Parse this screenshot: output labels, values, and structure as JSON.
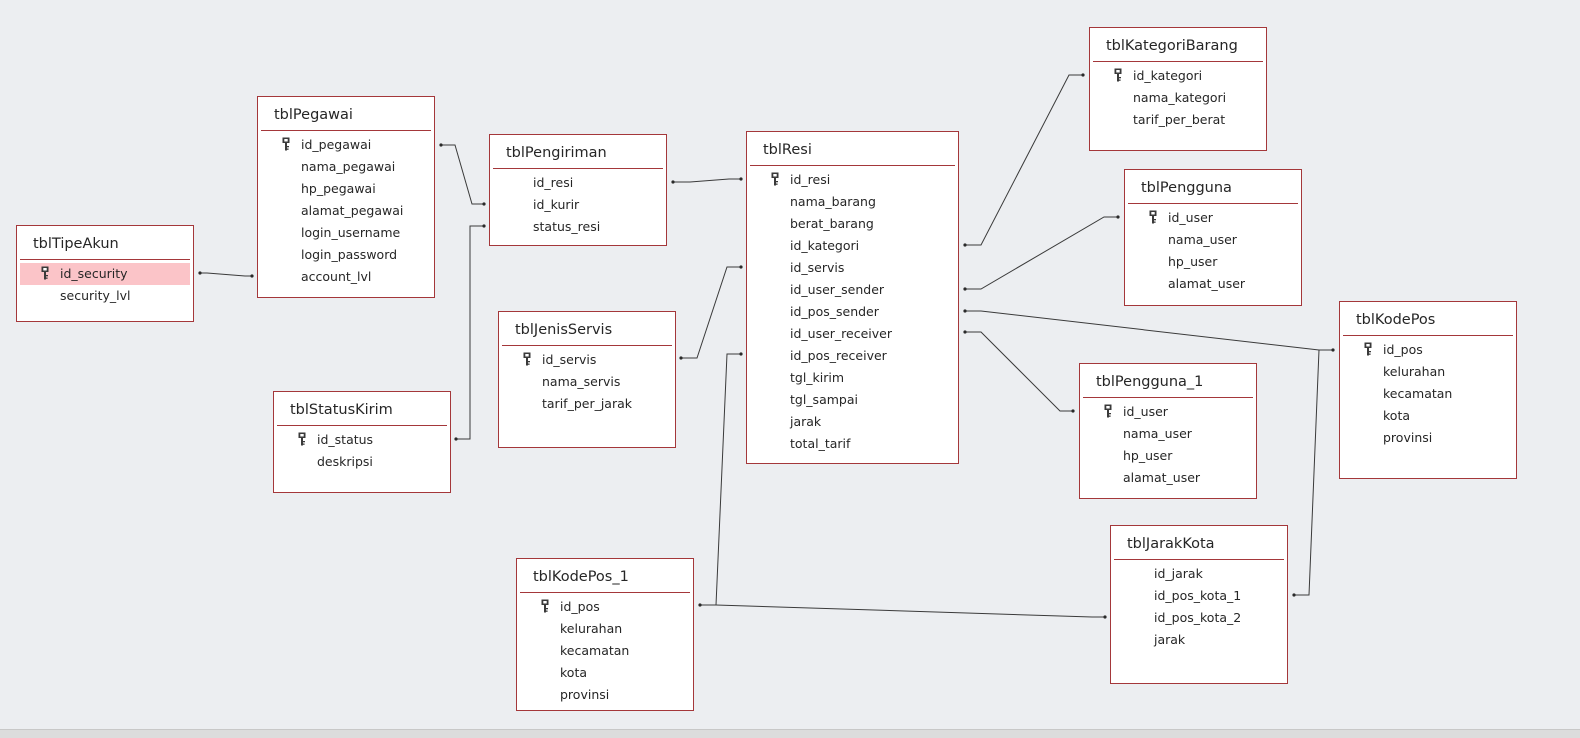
{
  "colors": {
    "background": "#eceef1",
    "table_border": "#a4373a",
    "selected_field": "#fbc4c8",
    "line": "#3a3a3a"
  },
  "tables": {
    "tipeakun": {
      "name": "tblTipeAkun",
      "fields": [
        {
          "name": "id_security",
          "pk": true,
          "selected": true
        },
        {
          "name": "security_lvl"
        }
      ]
    },
    "pegawai": {
      "name": "tblPegawai",
      "fields": [
        {
          "name": "id_pegawai",
          "pk": true
        },
        {
          "name": "nama_pegawai"
        },
        {
          "name": "hp_pegawai"
        },
        {
          "name": "alamat_pegawai"
        },
        {
          "name": "login_username"
        },
        {
          "name": "login_password"
        },
        {
          "name": "account_lvl"
        }
      ]
    },
    "statuskirim": {
      "name": "tblStatusKirim",
      "fields": [
        {
          "name": "id_status",
          "pk": true
        },
        {
          "name": "deskripsi"
        }
      ]
    },
    "pengiriman": {
      "name": "tblPengiriman",
      "fields": [
        {
          "name": "id_resi"
        },
        {
          "name": "id_kurir"
        },
        {
          "name": "status_resi"
        }
      ]
    },
    "jenisservis": {
      "name": "tblJenisServis",
      "fields": [
        {
          "name": "id_servis",
          "pk": true
        },
        {
          "name": "nama_servis"
        },
        {
          "name": "tarif_per_jarak"
        }
      ]
    },
    "kodepos1": {
      "name": "tblKodePos_1",
      "fields": [
        {
          "name": "id_pos",
          "pk": true
        },
        {
          "name": "kelurahan"
        },
        {
          "name": "kecamatan"
        },
        {
          "name": "kota"
        },
        {
          "name": "provinsi"
        }
      ]
    },
    "resi": {
      "name": "tblResi",
      "fields": [
        {
          "name": "id_resi",
          "pk": true
        },
        {
          "name": "nama_barang"
        },
        {
          "name": "berat_barang"
        },
        {
          "name": "id_kategori"
        },
        {
          "name": "id_servis"
        },
        {
          "name": "id_user_sender"
        },
        {
          "name": "id_pos_sender"
        },
        {
          "name": "id_user_receiver"
        },
        {
          "name": "id_pos_receiver"
        },
        {
          "name": "tgl_kirim"
        },
        {
          "name": "tgl_sampai"
        },
        {
          "name": "jarak"
        },
        {
          "name": "total_tarif"
        }
      ]
    },
    "kategoribarang": {
      "name": "tblKategoriBarang",
      "fields": [
        {
          "name": "id_kategori",
          "pk": true
        },
        {
          "name": "nama_kategori"
        },
        {
          "name": "tarif_per_berat"
        }
      ]
    },
    "pengguna": {
      "name": "tblPengguna",
      "fields": [
        {
          "name": "id_user",
          "pk": true
        },
        {
          "name": "nama_user"
        },
        {
          "name": "hp_user"
        },
        {
          "name": "alamat_user"
        }
      ]
    },
    "pengguna1": {
      "name": "tblPengguna_1",
      "fields": [
        {
          "name": "id_user",
          "pk": true
        },
        {
          "name": "nama_user"
        },
        {
          "name": "hp_user"
        },
        {
          "name": "alamat_user"
        }
      ]
    },
    "kodepos": {
      "name": "tblKodePos",
      "fields": [
        {
          "name": "id_pos",
          "pk": true
        },
        {
          "name": "kelurahan"
        },
        {
          "name": "kecamatan"
        },
        {
          "name": "kota"
        },
        {
          "name": "provinsi"
        }
      ]
    },
    "jarakkota": {
      "name": "tblJarakKota",
      "fields": [
        {
          "name": "id_jarak"
        },
        {
          "name": "id_pos_kota_1"
        },
        {
          "name": "id_pos_kota_2"
        },
        {
          "name": "jarak"
        }
      ]
    }
  },
  "relationships": [
    {
      "from": "tipeakun.id_security",
      "to": "pegawai.account_lvl"
    },
    {
      "from": "pegawai.id_pegawai",
      "to": "pengiriman.id_kurir"
    },
    {
      "from": "statuskirim.id_status",
      "to": "pengiriman.status_resi"
    },
    {
      "from": "pengiriman.id_resi",
      "to": "resi.id_resi"
    },
    {
      "from": "jenisservis.id_servis",
      "to": "resi.id_servis"
    },
    {
      "from": "kodepos1.id_pos",
      "to": "resi.id_pos_receiver"
    },
    {
      "from": "kodepos1.id_pos",
      "to": "jarakkota.id_pos_kota_2"
    },
    {
      "from": "resi.id_kategori",
      "to": "kategoribarang.id_kategori"
    },
    {
      "from": "resi.id_user_sender",
      "to": "pengguna.id_user"
    },
    {
      "from": "resi.id_pos_sender",
      "to": "kodepos.id_pos"
    },
    {
      "from": "resi.id_user_receiver",
      "to": "pengguna1.id_user"
    },
    {
      "from": "kodepos.id_pos",
      "to": "jarakkota.id_pos_kota_1"
    }
  ]
}
